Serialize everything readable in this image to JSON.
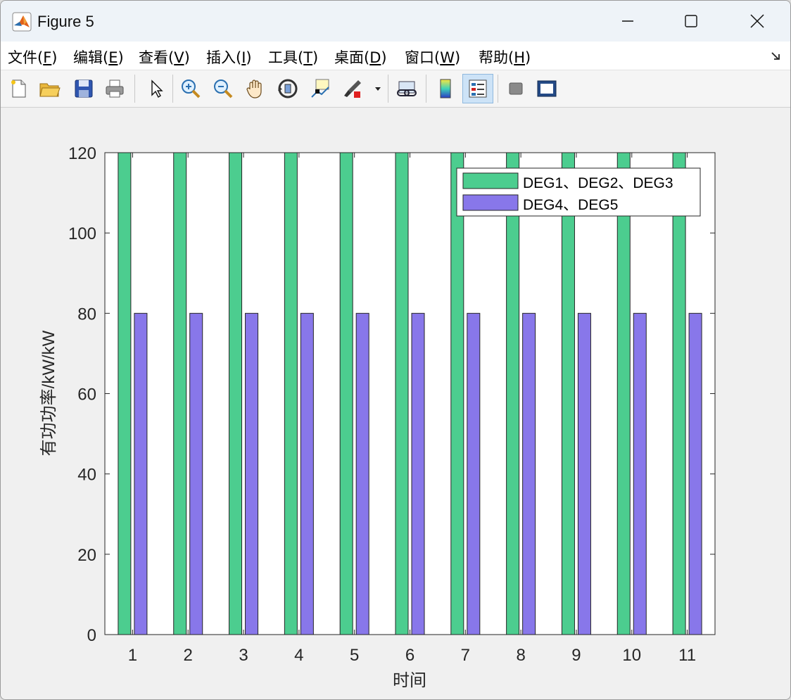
{
  "window": {
    "title": "Figure 5",
    "controls": [
      "minimize",
      "maximize",
      "close"
    ]
  },
  "menu": [
    {
      "pre": "文件(",
      "key": "F",
      "post": ")"
    },
    {
      "pre": "编辑(",
      "key": "E",
      "post": ")"
    },
    {
      "pre": "查看(",
      "key": "V",
      "post": ")"
    },
    {
      "pre": "插入(",
      "key": "I",
      "post": ")"
    },
    {
      "pre": "工具(",
      "key": "T",
      "post": ")"
    },
    {
      "pre": "桌面(",
      "key": "D",
      "post": ")"
    },
    {
      "pre": "窗口(",
      "key": "W",
      "post": ")"
    },
    {
      "pre": "帮助(",
      "key": "H",
      "post": ")"
    }
  ],
  "toolbar": {
    "icons": [
      "new-figure-icon",
      "open-file-icon",
      "save-icon",
      "print-icon",
      "select-arrow-icon",
      "zoom-in-icon",
      "zoom-out-icon",
      "pan-hand-icon",
      "rotate-3d-icon",
      "data-cursor-icon",
      "brush-icon",
      "link-plot-icon",
      "colorbar-icon",
      "legend-icon",
      "hide-plot-tools-icon",
      "show-plot-tools-icon"
    ],
    "active": "legend-icon"
  },
  "colors": {
    "series1": "#4ccd8f",
    "series2": "#8877ea",
    "axes_bg": "#ffffff",
    "figure_bg": "#f0f0f0"
  },
  "chart_data": {
    "type": "bar",
    "categories": [
      "1",
      "2",
      "3",
      "4",
      "5",
      "6",
      "7",
      "8",
      "9",
      "10",
      "11"
    ],
    "series": [
      {
        "name": "DEG1、DEG2、DEG3",
        "values": [
          120,
          120,
          120,
          120,
          120,
          120,
          120,
          120,
          120,
          120,
          120
        ]
      },
      {
        "name": "DEG4、DEG5",
        "values": [
          80,
          80,
          80,
          80,
          80,
          80,
          80,
          80,
          80,
          80,
          80
        ]
      }
    ],
    "xlabel": "时间",
    "ylabel": "有功功率/kW/kW",
    "ylim": [
      0,
      120
    ],
    "yticks": [
      0,
      20,
      40,
      60,
      80,
      100,
      120
    ],
    "grid": false,
    "legend_position": "top-right"
  }
}
